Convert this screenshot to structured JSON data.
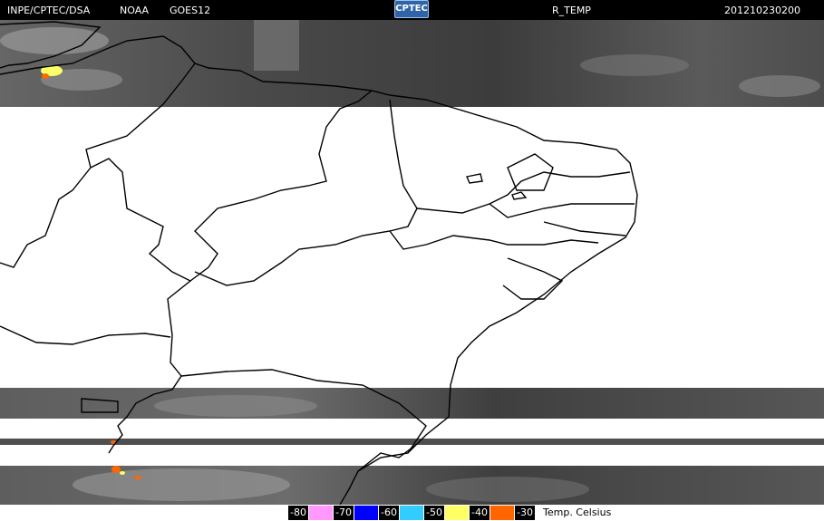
{
  "header": {
    "source": "INPE/CPTEC/DSA",
    "agency": "NOAA",
    "satellite": "GOES12",
    "logo_text": "CPTEC",
    "product": "R_TEMP",
    "timestamp": "201210230200"
  },
  "legend": {
    "caption": "Temp. Celsius",
    "entries": [
      {
        "label": "-80",
        "color": "#ff99ff"
      },
      {
        "label": "-70",
        "color": "#0000ff"
      },
      {
        "label": "-60",
        "color": "#33ccff"
      },
      {
        "label": "-50",
        "color": "#ffff66"
      },
      {
        "label": "-40",
        "color": "#ff6600"
      },
      {
        "label": "-30",
        "color": "#ff6600"
      }
    ]
  },
  "colors": {
    "cloud_gray": "#555555",
    "no_data": "#ffffff",
    "coastline": "#000000",
    "cold_top": "#ff6600",
    "very_cold_top": "#ffff66"
  }
}
